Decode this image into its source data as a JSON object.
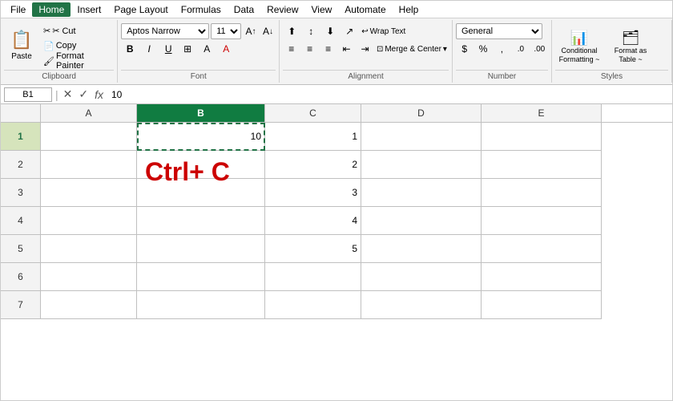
{
  "menubar": {
    "items": [
      "File",
      "Home",
      "Insert",
      "Page Layout",
      "Formulas",
      "Data",
      "Review",
      "View",
      "Automate",
      "Help"
    ]
  },
  "ribbon": {
    "tabs": [
      "File",
      "Home",
      "Insert",
      "Page Layout",
      "Formulas",
      "Data",
      "Review",
      "View",
      "Automate",
      "Help"
    ],
    "active_tab": "Home",
    "groups": {
      "clipboard": {
        "label": "Clipboard",
        "paste_label": "Paste",
        "cut_label": "✂ Cut",
        "copy_label": "📋 Copy",
        "format_painter_label": "Format Painter"
      },
      "font": {
        "label": "Font",
        "font_name": "Aptos Narrow",
        "font_size": "11",
        "bold": "B",
        "italic": "I",
        "underline": "U",
        "increase_size": "A↑",
        "decrease_size": "A↓"
      },
      "alignment": {
        "label": "Alignment",
        "wrap_text": "Wrap Text",
        "merge_center": "Merge & Center"
      },
      "number": {
        "label": "Number",
        "format": "General"
      },
      "styles": {
        "label": "Styles",
        "conditional_formatting": "Conditional Formatting ~",
        "format_as_table": "Format as Table ~"
      }
    }
  },
  "formula_bar": {
    "cell_ref": "B1",
    "formula_value": "10"
  },
  "spreadsheet": {
    "columns": [
      "A",
      "B",
      "C",
      "D",
      "E"
    ],
    "active_col": "B",
    "active_row": 1,
    "rows": [
      {
        "row": 1,
        "cells": {
          "A": "",
          "B": "10",
          "C": "1",
          "D": "",
          "E": ""
        }
      },
      {
        "row": 2,
        "cells": {
          "A": "",
          "B": "",
          "C": "2",
          "D": "",
          "E": ""
        }
      },
      {
        "row": 3,
        "cells": {
          "A": "",
          "B": "",
          "C": "3",
          "D": "",
          "E": ""
        }
      },
      {
        "row": 4,
        "cells": {
          "A": "",
          "B": "",
          "C": "4",
          "D": "",
          "E": ""
        }
      },
      {
        "row": 5,
        "cells": {
          "A": "",
          "B": "",
          "C": "5",
          "D": "",
          "E": ""
        }
      },
      {
        "row": 6,
        "cells": {
          "A": "",
          "B": "",
          "C": "",
          "D": "",
          "E": ""
        }
      },
      {
        "row": 7,
        "cells": {
          "A": "",
          "B": "",
          "C": "",
          "D": "",
          "E": ""
        }
      }
    ],
    "ctrl_c_text": "Ctrl+ C"
  }
}
